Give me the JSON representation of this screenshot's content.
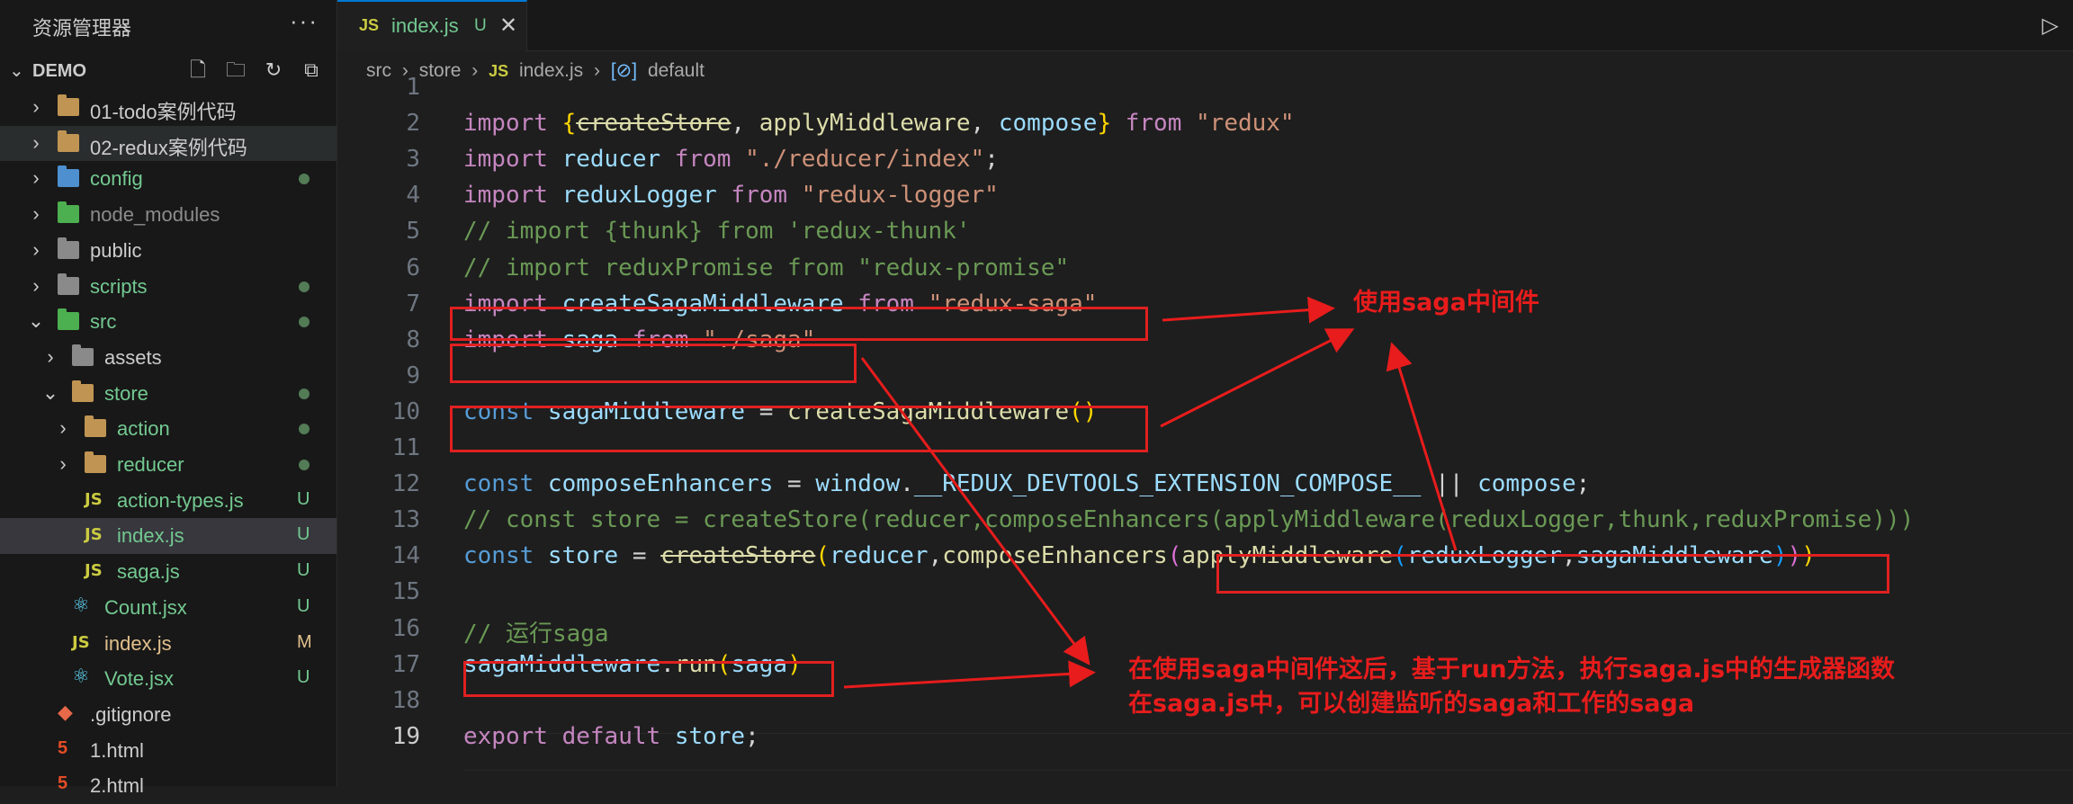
{
  "sidebar": {
    "title": "资源管理器",
    "more": "···",
    "workspace": "DEMO",
    "items": [
      {
        "name": "01-todo案例代码",
        "type": "folder",
        "indent": 1,
        "expanded": false
      },
      {
        "name": "02-redux案例代码",
        "type": "folder",
        "indent": 1,
        "expanded": false
      },
      {
        "name": "config",
        "type": "folder",
        "indent": 1,
        "expanded": false
      },
      {
        "name": "node_modules",
        "type": "folder",
        "indent": 1,
        "expanded": false
      },
      {
        "name": "public",
        "type": "folder",
        "indent": 1,
        "expanded": false
      },
      {
        "name": "scripts",
        "type": "folder",
        "indent": 1,
        "expanded": false
      },
      {
        "name": "src",
        "type": "folder",
        "indent": 1,
        "expanded": true
      },
      {
        "name": "assets",
        "type": "folder",
        "indent": 2,
        "expanded": false
      },
      {
        "name": "store",
        "type": "folder",
        "indent": 2,
        "expanded": true
      },
      {
        "name": "action",
        "type": "folder",
        "indent": 3,
        "expanded": false
      },
      {
        "name": "reducer",
        "type": "folder",
        "indent": 3,
        "expanded": false
      },
      {
        "name": "action-types.js",
        "type": "js",
        "indent": 3,
        "badge": "U"
      },
      {
        "name": "index.js",
        "type": "js",
        "indent": 3,
        "badge": "U"
      },
      {
        "name": "saga.js",
        "type": "js",
        "indent": 3,
        "badge": "U"
      },
      {
        "name": "Count.jsx",
        "type": "react",
        "indent": 2,
        "badge": "U"
      },
      {
        "name": "index.js",
        "type": "js",
        "indent": 2,
        "badge": "M"
      },
      {
        "name": "Vote.jsx",
        "type": "react",
        "indent": 2,
        "badge": "U"
      },
      {
        "name": ".gitignore",
        "type": "git",
        "indent": 1
      },
      {
        "name": "1.html",
        "type": "html",
        "indent": 1
      },
      {
        "name": "2.html",
        "type": "html",
        "indent": 1
      }
    ]
  },
  "tab": {
    "icon": "JS",
    "name": "index.js",
    "badge": "U",
    "close": "✕"
  },
  "breadcrumb": {
    "p1": "src",
    "p2": "store",
    "icon": "JS",
    "p3": "index.js",
    "p4": "default",
    "sep": "›"
  },
  "line_numbers": [
    "1",
    "2",
    "3",
    "4",
    "5",
    "6",
    "7",
    "8",
    "9",
    "10",
    "11",
    "12",
    "13",
    "14",
    "15",
    "16",
    "17",
    "18",
    "19"
  ],
  "code": {
    "l2": [
      "import ",
      "{",
      "createStore",
      ", ",
      "applyMiddleware",
      ", ",
      "compose",
      "}",
      " from ",
      "\"redux\""
    ],
    "l3": [
      "import ",
      "reducer",
      " from ",
      "\"./reducer/index\"",
      ";"
    ],
    "l4": [
      "import ",
      "reduxLogger",
      " from ",
      "\"redux-logger\""
    ],
    "l5": "// import {thunk} from 'redux-thunk'",
    "l6": "// import reduxPromise from \"redux-promise\"",
    "l7": [
      "import ",
      "createSagaMiddleware",
      " from ",
      "\"redux-saga\""
    ],
    "l8": [
      "import ",
      "saga",
      " from ",
      "\"./saga\""
    ],
    "l10": [
      "const ",
      "sagaMiddleware",
      " = ",
      "createSagaMiddleware",
      "()"
    ],
    "l12": [
      "const ",
      "composeEnhancers",
      " = ",
      "window",
      ".",
      "__REDUX_DEVTOOLS_EXTENSION_COMPOSE__",
      " || ",
      "compose",
      ";"
    ],
    "l13": "// const store = createStore(reducer,composeEnhancers(applyMiddleware(reduxLogger,thunk,reduxPromise)))",
    "l14": [
      "const ",
      "store",
      " = ",
      "createStore",
      "(",
      "reducer",
      ",",
      "composeEnhancers",
      "(",
      "applyMiddleware",
      "(",
      "reduxLogger",
      ",",
      "sagaMiddleware",
      ")",
      ")",
      ")"
    ],
    "l16": "// 运行saga",
    "l17": [
      "sagaMiddleware",
      ".",
      "run",
      "(",
      "saga",
      ")"
    ],
    "l19": [
      "export ",
      "default ",
      "store",
      ";"
    ]
  },
  "annotations": {
    "a1": "使用saga中间件",
    "a2": "在使用saga中间件这后，基于run方法，执行saga.js中的生成器函数",
    "a3": "在saga.js中，可以创建监听的saga和工作的saga"
  },
  "colors": {
    "annotation_red": "#e81c1c",
    "keyword": "#c586c0",
    "string": "#ce9178",
    "variable": "#9cdcfe",
    "function": "#dcdcaa",
    "comment": "#6a9955"
  }
}
